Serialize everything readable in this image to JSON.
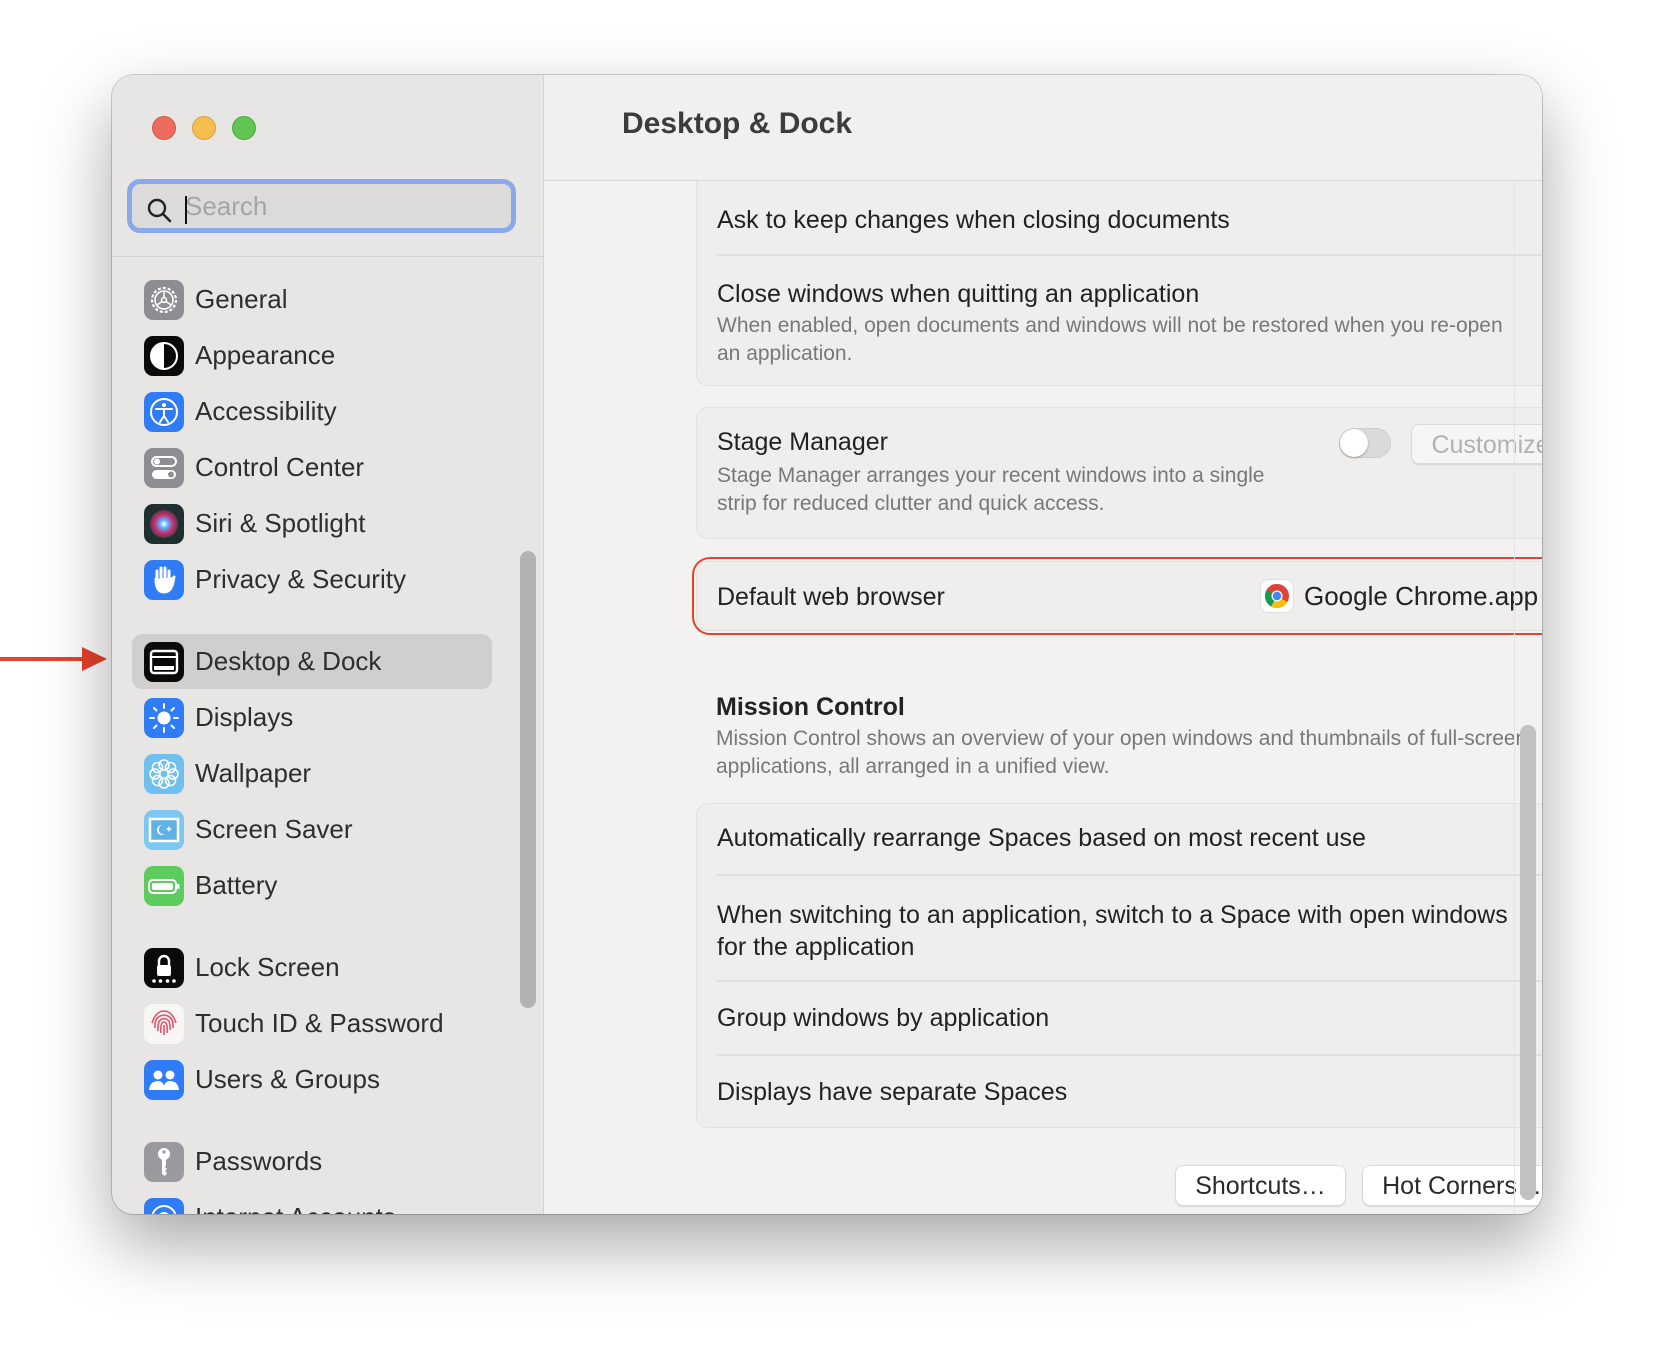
{
  "window": {
    "title": "Desktop & Dock",
    "traffic_lights": [
      "close",
      "minimize",
      "zoom"
    ]
  },
  "sidebar": {
    "search": {
      "placeholder": "Search",
      "value": ""
    },
    "items": [
      {
        "label": "General",
        "icon": "gear-icon",
        "selected": false
      },
      {
        "label": "Appearance",
        "icon": "appearance-icon",
        "selected": false
      },
      {
        "label": "Accessibility",
        "icon": "accessibility-icon",
        "selected": false
      },
      {
        "label": "Control Center",
        "icon": "control-center-icon",
        "selected": false
      },
      {
        "label": "Siri & Spotlight",
        "icon": "siri-icon",
        "selected": false
      },
      {
        "label": "Privacy & Security",
        "icon": "hand-icon",
        "selected": false
      },
      {
        "label": "Desktop & Dock",
        "icon": "desktop-dock-icon",
        "selected": true
      },
      {
        "label": "Displays",
        "icon": "sun-icon",
        "selected": false
      },
      {
        "label": "Wallpaper",
        "icon": "wallpaper-icon",
        "selected": false
      },
      {
        "label": "Screen Saver",
        "icon": "screen-saver-icon",
        "selected": false
      },
      {
        "label": "Battery",
        "icon": "battery-icon",
        "selected": false
      },
      {
        "label": "Lock Screen",
        "icon": "lock-icon",
        "selected": false
      },
      {
        "label": "Touch ID & Password",
        "icon": "fingerprint-icon",
        "selected": false
      },
      {
        "label": "Users & Groups",
        "icon": "users-icon",
        "selected": false
      },
      {
        "label": "Passwords",
        "icon": "key-icon",
        "selected": false
      },
      {
        "label": "Internet Accounts",
        "icon": "at-icon",
        "selected": false
      }
    ]
  },
  "content": {
    "windows_card": {
      "rows": [
        {
          "title": "Ask to keep changes when closing documents",
          "description": "",
          "enabled": false
        },
        {
          "title": "Close windows when quitting an application",
          "description": "When enabled, open documents and windows will not be restored when you re-open an application.",
          "enabled": true
        }
      ]
    },
    "stage_manager": {
      "title": "Stage Manager",
      "description": "Stage Manager arranges your recent windows into a single strip for reduced clutter and quick access.",
      "enabled": false,
      "customize_label": "Customize…"
    },
    "default_browser": {
      "label": "Default web browser",
      "value": "Google Chrome.app",
      "icon": "chrome-icon"
    },
    "mission_control": {
      "title": "Mission Control",
      "description": "Mission Control shows an overview of your open windows and thumbnails of full-screen applications, all arranged in a unified view.",
      "rows": [
        {
          "title": "Automatically rearrange Spaces based on most recent use",
          "enabled": true
        },
        {
          "title": "When switching to an application, switch to a Space with open windows for the application",
          "enabled": false
        },
        {
          "title": "Group windows by application",
          "enabled": false
        },
        {
          "title": "Displays have separate Spaces",
          "enabled": true
        }
      ]
    },
    "footer": {
      "shortcuts_label": "Shortcuts…",
      "hot_corners_label": "Hot Corners…",
      "help_label": "?"
    }
  },
  "annotation": {
    "arrow_target": "Desktop & Dock",
    "highlight_target": "Default web browser",
    "color": "#e8412c"
  },
  "colors": {
    "accent": "#3b82f0",
    "annotation": "#e8412c"
  }
}
